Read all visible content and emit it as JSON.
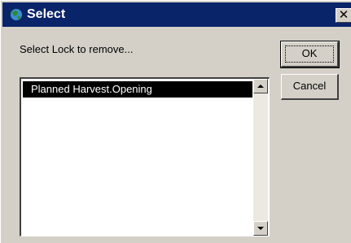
{
  "window": {
    "title": "Select",
    "close_label": "✕"
  },
  "dialog": {
    "prompt": "Select Lock to remove...",
    "items": [
      {
        "label": "Planned Harvest.Opening",
        "selected": true
      }
    ]
  },
  "buttons": {
    "ok_label": "OK",
    "cancel_label": "Cancel"
  },
  "colors": {
    "titlebar": "#0a246a",
    "face": "#d4d0c8",
    "selection": "#000000"
  },
  "icons": {
    "title": "globe-icon",
    "close": "close-icon",
    "scroll_up": "triangle-up-icon",
    "scroll_down": "triangle-down-icon"
  }
}
